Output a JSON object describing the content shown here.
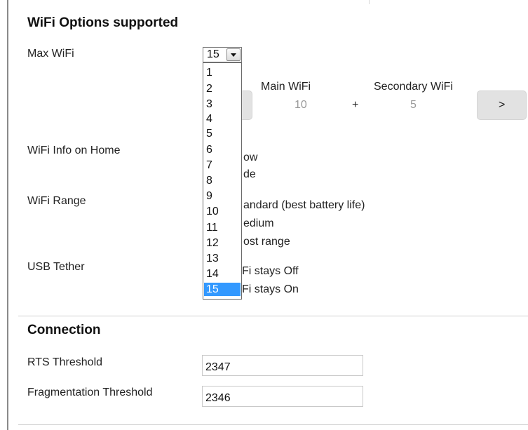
{
  "wifi_options": {
    "title": "WiFi Options supported",
    "max_wifi": {
      "label": "Max WiFi",
      "selected": "15",
      "options": [
        "1",
        "2",
        "3",
        "4",
        "5",
        "6",
        "7",
        "8",
        "9",
        "10",
        "11",
        "12",
        "13",
        "14",
        "15"
      ]
    },
    "split": {
      "main_label": "Main WiFi",
      "main_value": "10",
      "plus": "+",
      "secondary_label": "Secondary WiFi",
      "secondary_value": "5",
      "next_label": ">"
    },
    "info_on_home": {
      "label": "WiFi Info on Home",
      "options_visible": [
        "ow",
        "de"
      ]
    },
    "range": {
      "label": "WiFi Range",
      "options_visible": [
        "andard (best battery life)",
        "edium",
        "ost range"
      ]
    },
    "usb_tether": {
      "label": "USB Tether",
      "options_visible": [
        "Fi stays Off",
        "Fi stays On"
      ]
    }
  },
  "connection": {
    "title": "Connection",
    "rts": {
      "label": "RTS Threshold",
      "value": "2347"
    },
    "fragmentation": {
      "label": "Fragmentation Threshold",
      "value": "2346"
    }
  },
  "colors": {
    "selected_highlight": "#3399ff",
    "button_grey": "#e2e2e2",
    "split_value_grey": "#9a9a9a"
  }
}
